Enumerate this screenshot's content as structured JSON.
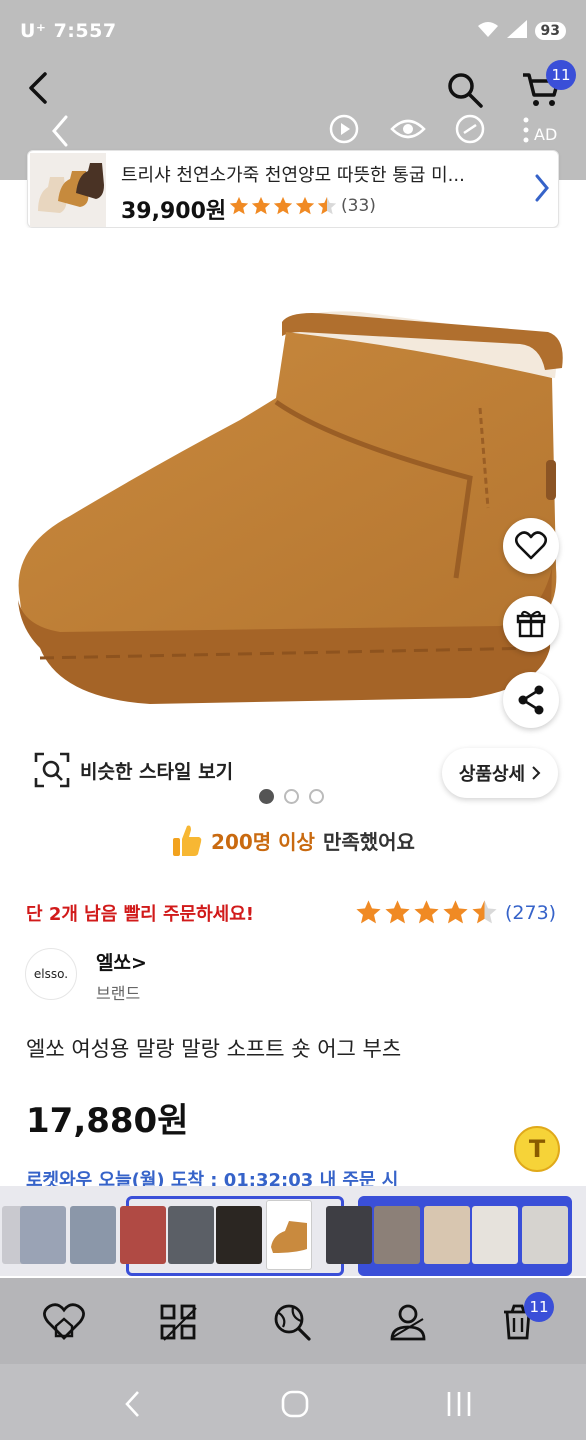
{
  "status_bar": {
    "time": "U⁺ 7:557",
    "battery": "93"
  },
  "header": {
    "cart_count": "11",
    "ad_label": "AD"
  },
  "mini_card": {
    "title": "트리샤 천연소가죽 천연양모 따뜻한 통굽 미...",
    "price": "39,900원",
    "rating": 4.5,
    "review_count": "(33)"
  },
  "hero": {
    "similar_style_label": "비슷한 스타일 보기",
    "detail_label": "상품상세",
    "image_page": 1,
    "image_total": 3
  },
  "satisfaction": {
    "count_text": "200명 이상",
    "suffix_text": "만족했어요"
  },
  "stock_warning": "단 2개 남음 빨리 주문하세요!",
  "rating": {
    "value": 4.5,
    "count": "(273)"
  },
  "brand": {
    "logo_text": "elsso.",
    "name": "엘쏘>",
    "type": "브랜드"
  },
  "product": {
    "name": "엘쏘 여성용 말랑 말랑 소프트 숏 어그 부츠",
    "price": "17,880원",
    "delivery": "로켓와우 오늘(월) 도착 : 01:32:03 내 주문 시"
  },
  "toolbar": {
    "badge_count": "11"
  },
  "colors": {
    "accent_blue": "#3a4fd8",
    "link_blue": "#3663c9",
    "warning_red": "#d11a1a",
    "star_orange": "#f08a24",
    "satisfaction_orange": "#c96a10"
  }
}
